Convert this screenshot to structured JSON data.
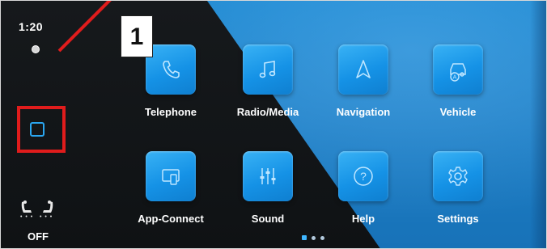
{
  "status": {
    "time": "1:20"
  },
  "sidebar": {
    "home_icon": "home-square-icon",
    "seat_climate_label": "OFF"
  },
  "callout": {
    "number": "1",
    "color": "#e01c1c"
  },
  "apps": [
    {
      "label": "Telephone",
      "icon": "phone-icon"
    },
    {
      "label": "Radio/Media",
      "icon": "music-note-icon"
    },
    {
      "label": "Navigation",
      "icon": "navigation-arrow-icon"
    },
    {
      "label": "Vehicle",
      "icon": "car-icon"
    },
    {
      "label": "App-Connect",
      "icon": "phone-mirror-icon"
    },
    {
      "label": "Sound",
      "icon": "equalizer-icon"
    },
    {
      "label": "Help",
      "icon": "question-icon"
    },
    {
      "label": "Settings",
      "icon": "gear-icon"
    }
  ],
  "pagination": {
    "pages": 3,
    "current": 1
  },
  "colors": {
    "accent": "#2aa6f0",
    "tile": "#1592e6"
  }
}
